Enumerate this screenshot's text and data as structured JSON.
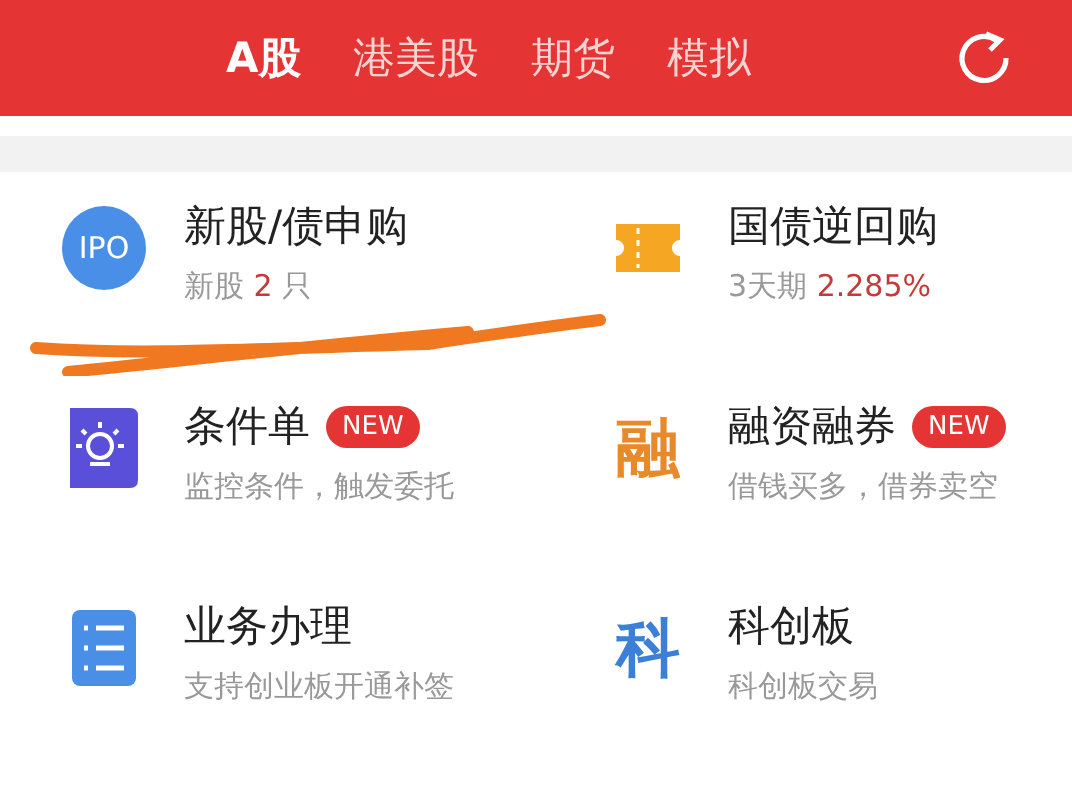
{
  "tabs": [
    {
      "label": "A股",
      "selected": true
    },
    {
      "label": "港美股",
      "selected": false
    },
    {
      "label": "期货",
      "selected": false
    },
    {
      "label": "模拟",
      "selected": false
    }
  ],
  "services": [
    {
      "title": "新股/债申购",
      "icon": {
        "kind": "circle-text",
        "text": "IPO"
      },
      "subtitle": [
        {
          "text": "新股 ",
          "highlight": false
        },
        {
          "text": "2",
          "highlight": true
        },
        {
          "text": " 只",
          "highlight": false
        }
      ]
    },
    {
      "title": "国债逆回购",
      "icon": {
        "kind": "ticket"
      },
      "subtitle": [
        {
          "text": "3天期 ",
          "highlight": false
        },
        {
          "text": "2.285%",
          "highlight": true
        }
      ]
    },
    {
      "title": "条件单",
      "icon": {
        "kind": "bulb"
      },
      "badge": "NEW",
      "subtitle": [
        {
          "text": "监控条件，触发委托",
          "highlight": false
        }
      ]
    },
    {
      "title": "融资融券",
      "icon": {
        "kind": "glyph",
        "text": "融",
        "color": "#e8892a"
      },
      "badge": "NEW",
      "subtitle": [
        {
          "text": "借钱买多，借券卖空",
          "highlight": false
        }
      ]
    },
    {
      "title": "业务办理",
      "icon": {
        "kind": "list"
      },
      "subtitle": [
        {
          "text": "支持创业板开通补签",
          "highlight": false
        }
      ]
    },
    {
      "title": "科创板",
      "icon": {
        "kind": "glyph",
        "text": "科",
        "color": "#3b7fd6"
      },
      "subtitle": [
        {
          "text": "科创板交易",
          "highlight": false
        }
      ]
    }
  ]
}
